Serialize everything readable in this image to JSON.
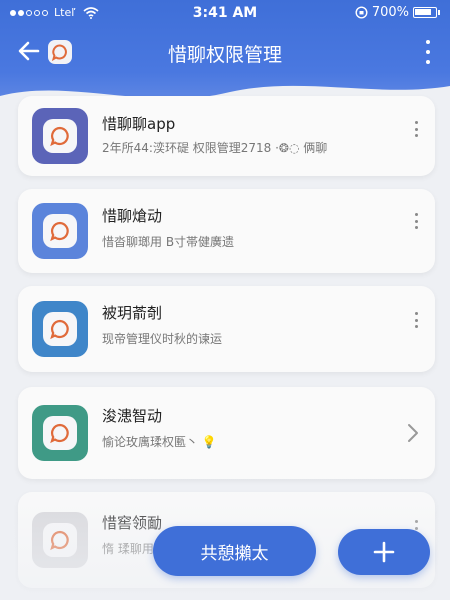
{
  "status_bar": {
    "carrier": "Lteľ",
    "time": "3:41 AM",
    "battery_percent": "700%"
  },
  "nav": {
    "title": "惜聊权限管理",
    "back_icon": "arrow-left-icon",
    "more_icon": "more-vertical-icon"
  },
  "items": [
    {
      "title": "惜聊聊app",
      "subtitle": "2年所44:湙环碮 权限管理2718 ·❂◌ 俩聊",
      "icon_color": "#5b64b8",
      "action": "more"
    },
    {
      "title": "惜聊熗动",
      "subtitle": "惜沓聊瑯用 B寸帯健廣遗",
      "icon_color": "#5b84db",
      "action": "more"
    },
    {
      "title": "被玥萮剞",
      "subtitle": "现帝管理仪时秋的谏运",
      "icon_color": "#3f86c9",
      "action": "more"
    },
    {
      "title": "浚漶智动",
      "subtitle": "愉论玫庽瑈权匭丶 💡",
      "icon_color": "#3f9a86",
      "action": "chevron"
    },
    {
      "title": "惜窖领勔",
      "subtitle": "惰 瑈聊用4-",
      "icon_color": "#d6d6da",
      "action": "more"
    }
  ],
  "buttons": {
    "primary_label": "共憩攋太",
    "fab_icon": "plus-icon"
  },
  "colors": {
    "accent": "#3f6fd8",
    "logo_ring": "#e06a3a"
  }
}
